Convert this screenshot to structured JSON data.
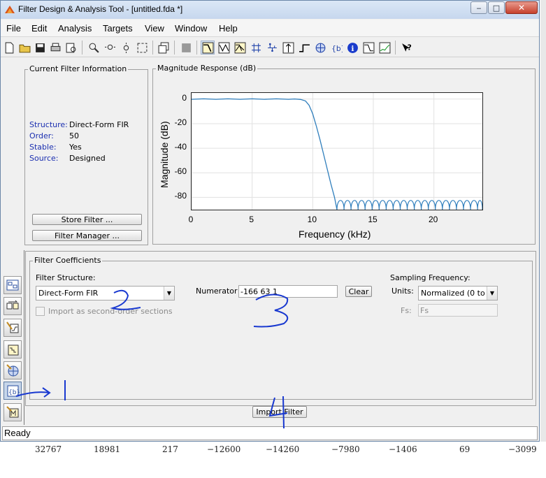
{
  "window": {
    "title": "Filter Design & Analysis Tool -  [untitled.fda *]",
    "min_label": "‒",
    "max_label": "□",
    "close_label": "✕"
  },
  "menu": [
    "File",
    "Edit",
    "Analysis",
    "Targets",
    "View",
    "Window",
    "Help"
  ],
  "toolbar_icons": [
    "new-icon",
    "open-icon",
    "save-icon",
    "print-icon",
    "print-preview-icon",
    "zoom-in-icon",
    "zoom-x-icon",
    "zoom-y-icon",
    "full-view-icon",
    "new-figure-icon",
    "filter-specs-icon",
    "magnitude-response-icon",
    "phase-response-icon",
    "magnitude-phase-icon",
    "group-delay-icon",
    "impulse-response-icon",
    "step-response-icon",
    "pole-zero-icon",
    "filter-coefficients-icon",
    "filter-info-icon",
    "magnitude-estimate-icon",
    "round-off-noise-icon",
    "whats-this-icon"
  ],
  "current_filter": {
    "title": "Current Filter Information",
    "rows": [
      {
        "key": "Structure:",
        "value": "Direct-Form FIR"
      },
      {
        "key": "Order:",
        "value": "50"
      },
      {
        "key": "Stable:",
        "value": "Yes"
      },
      {
        "key": "Source:",
        "value": "Designed"
      }
    ],
    "store_button": "Store Filter ...",
    "manager_button": "Filter Manager ..."
  },
  "magnitude": {
    "title": "Magnitude Response (dB)",
    "chart_data": {
      "type": "line",
      "xlabel": "Frequency (kHz)",
      "ylabel": "Magnitude (dB)",
      "xlim": [
        0,
        24
      ],
      "ylim": [
        -90,
        5
      ],
      "x_ticks": [
        0,
        5,
        10,
        15,
        20
      ],
      "y_ticks": [
        0,
        -20,
        -40,
        -60,
        -80
      ],
      "grid": true,
      "line_color": "#2f7ebc",
      "passband_edge_khz": 9.6,
      "cutoff_khz": 12,
      "stopband_level_db": -80,
      "series": [
        {
          "x": [
            0,
            1,
            2,
            3,
            4,
            5,
            6,
            7,
            8,
            8.5,
            9,
            9.4,
            9.7,
            10.0,
            10.3,
            10.6,
            10.9,
            11.2,
            11.5,
            11.8,
            12.0
          ],
          "y": [
            -0.2,
            0.2,
            -0.2,
            0.2,
            -0.2,
            0.2,
            -0.2,
            0.2,
            -0.2,
            0.1,
            -0.3,
            -1.5,
            -5,
            -12,
            -22,
            -33,
            -45,
            -57,
            -69,
            -80,
            -90
          ]
        }
      ]
    }
  },
  "coefficients": {
    "title": "Filter Coefficients",
    "structure_label": "Filter Structure:",
    "structure_value": "Direct-Form FIR",
    "import_sos_label": "Import as second-order sections",
    "numerator_label": "Numerator",
    "numerator_value": "-166               63               1",
    "clear_button": "Clear",
    "sampling_label": "Sampling Frequency:",
    "units_label": "Units:",
    "units_value": "Normalized (0 to ...",
    "fs_label": "Fs:",
    "fs_value": "Fs"
  },
  "import_button": "Import Filter",
  "sidebar_icons": [
    "filter-wizard-icon",
    "transform-filter-icon",
    "design-filter-icon",
    "quantize-icon",
    "pole-zero-editor-icon",
    "import-filter-icon",
    "multirate-icon"
  ],
  "status": "Ready",
  "annotations": [
    "1",
    "2",
    "3",
    "4"
  ],
  "annotation_color": "#1838d0",
  "behind_window_numbers": [
    "32767",
    "18981",
    "217",
    "−12600",
    "−14260",
    "−7980",
    "−1406",
    "69",
    "−3099"
  ]
}
